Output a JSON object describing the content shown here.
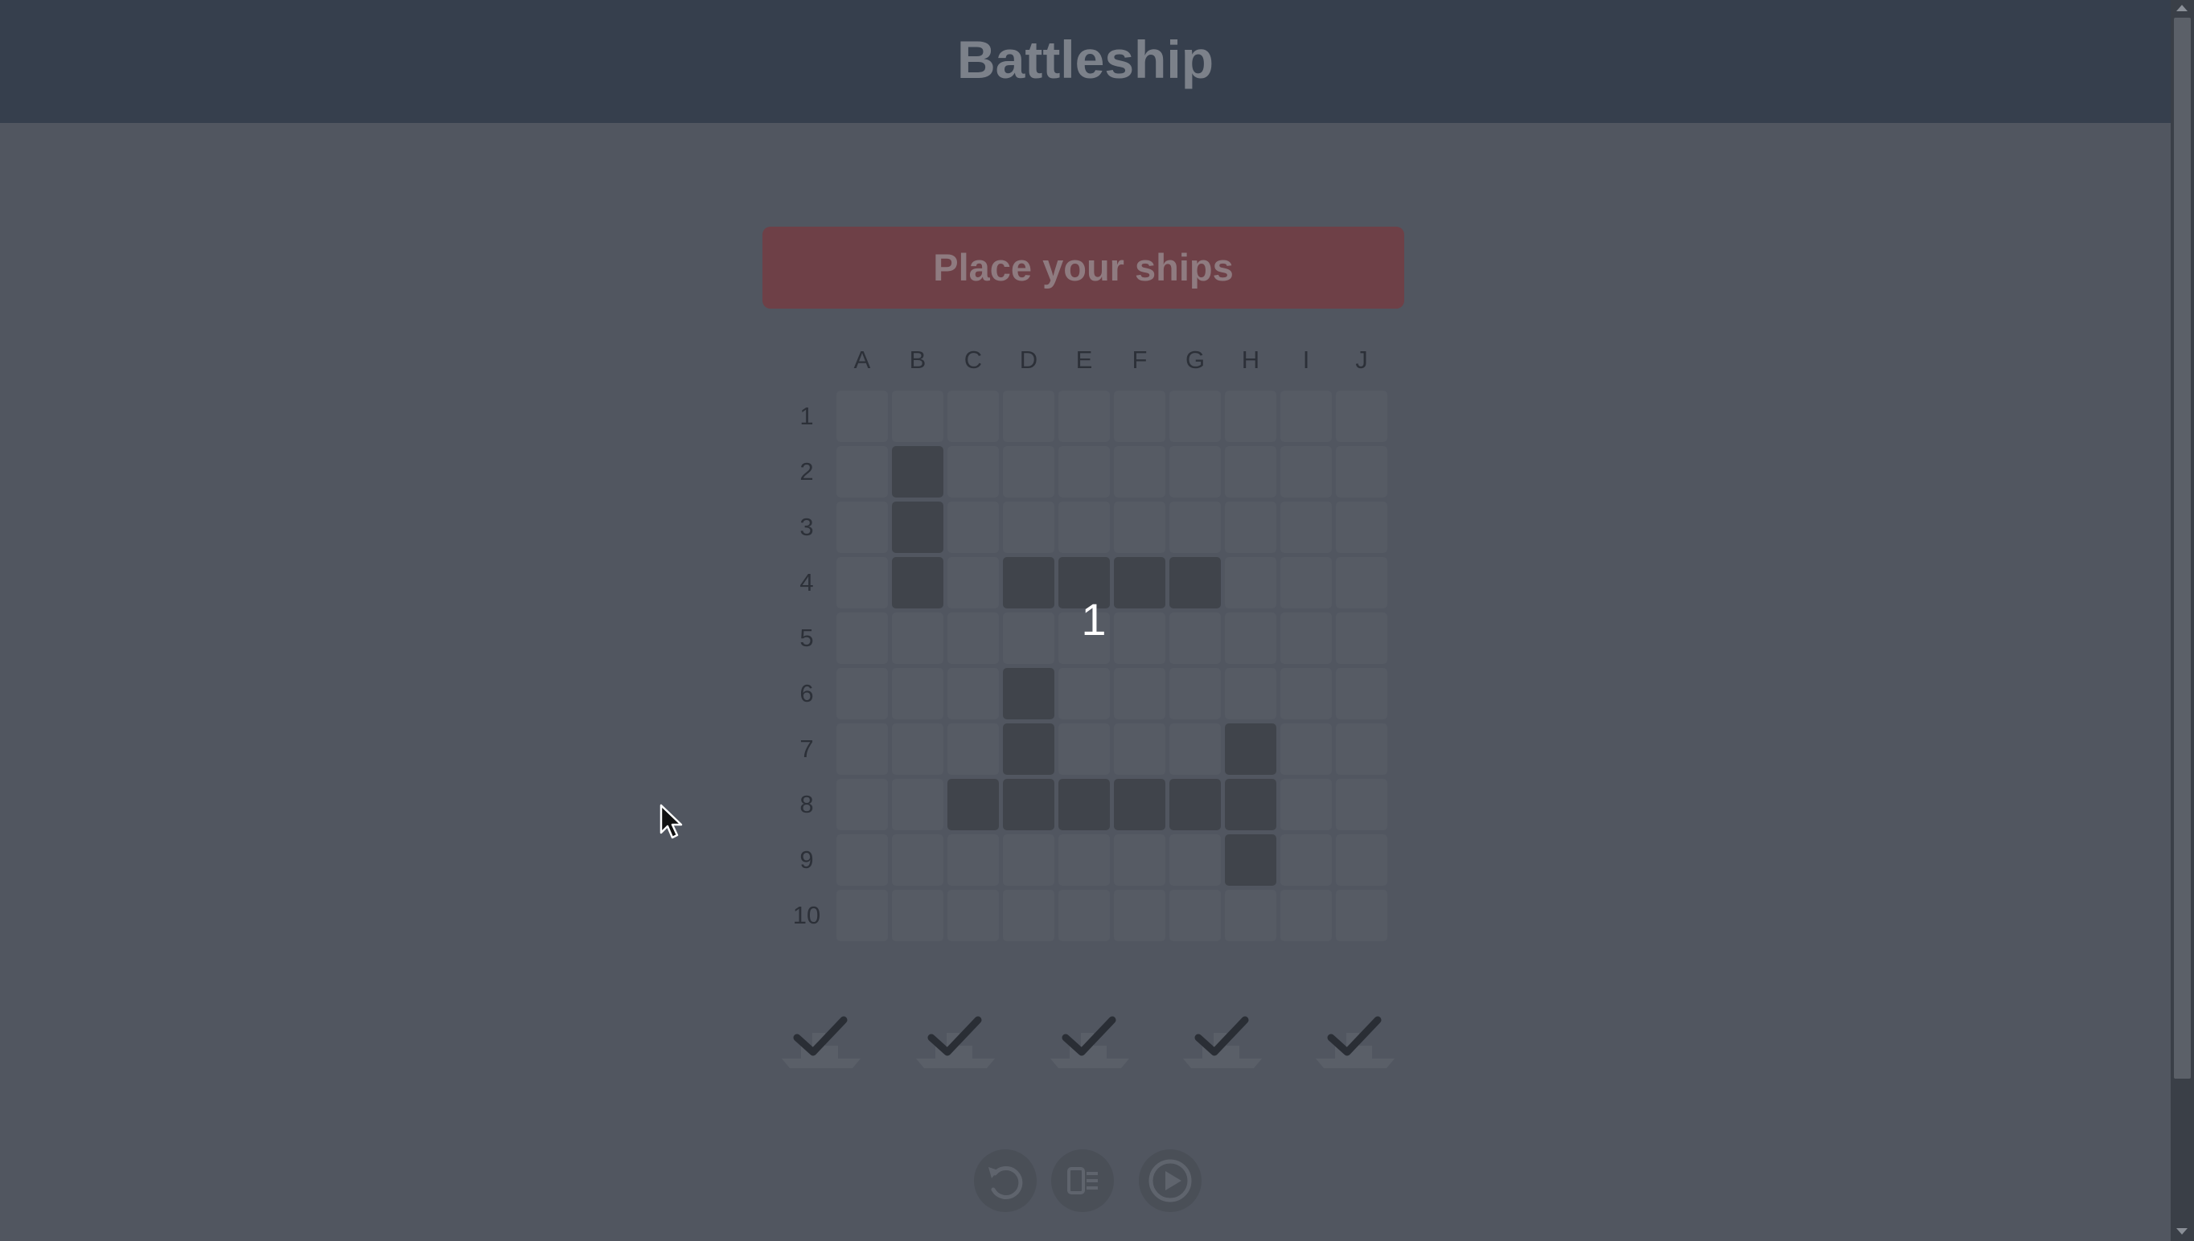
{
  "header": {
    "title": "Battleship"
  },
  "banner": {
    "text": "Place your ships"
  },
  "board": {
    "columns": [
      "A",
      "B",
      "C",
      "D",
      "E",
      "F",
      "G",
      "H",
      "I",
      "J"
    ],
    "rows": [
      "1",
      "2",
      "3",
      "4",
      "5",
      "6",
      "7",
      "8",
      "9",
      "10"
    ],
    "ship_cells": [
      "B2",
      "B3",
      "B4",
      "D4",
      "E4",
      "F4",
      "G4",
      "D6",
      "D7",
      "H7",
      "C8",
      "D8",
      "E8",
      "F8",
      "G8",
      "H8",
      "H9"
    ],
    "overlay_counter": "1"
  },
  "fleet": [
    {
      "name": "fleet-ship-1",
      "icon": "ship-icon",
      "status": "placed"
    },
    {
      "name": "fleet-ship-2",
      "icon": "ship-icon",
      "status": "placed"
    },
    {
      "name": "fleet-ship-3",
      "icon": "ship-icon",
      "status": "placed"
    },
    {
      "name": "fleet-ship-4",
      "icon": "ship-icon",
      "status": "placed"
    },
    {
      "name": "fleet-ship-5",
      "icon": "ship-icon",
      "status": "placed"
    }
  ],
  "controls": [
    {
      "name": "reset-button",
      "icon": "rotate-ccw-icon"
    },
    {
      "name": "randomize-button",
      "icon": "shuffle-board-icon"
    },
    {
      "name": "start-button",
      "icon": "play-icon"
    }
  ],
  "colors": {
    "header_bg": "#363f4d",
    "page_bg": "#515660",
    "banner_bg": "#6e4047",
    "cell_empty": "#565b64",
    "cell_ship": "#40444b"
  }
}
